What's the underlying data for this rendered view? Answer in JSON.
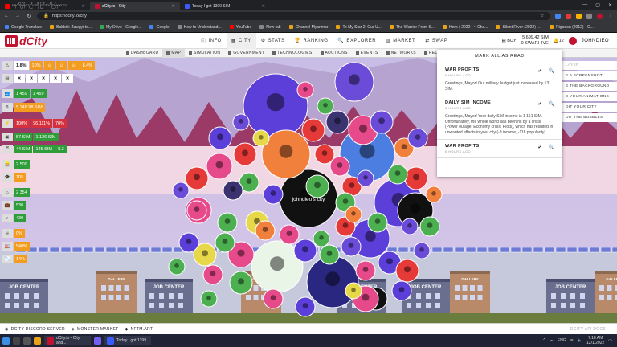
{
  "browser": {
    "tabs": [
      {
        "title": "မနက်ဖြန်လည်း တို့ပြင်ဆင်ကြမှာလား",
        "color": "#ff0000",
        "active": false
      },
      {
        "title": "dCity.io - City",
        "color": "#c3122f",
        "active": true
      },
      {
        "title": "Today I got 1399 SIM",
        "color": "#3a5cff",
        "active": false
      }
    ],
    "url": "https://dcity.io/city",
    "bookmarks": [
      "Google Translate",
      "Babbitt: Zawgyi to...",
      "My Drive - Google...",
      "Google",
      "How to Understand...",
      "YouTube",
      "New tab",
      "Channel Myanmar",
      "To My Star 2: Our U...",
      "The Warrior From S...",
      "Hero ( 2022 ) ~ Cha...",
      "Silent River (2022) -...",
      "Rigodon (2012) - C..."
    ]
  },
  "header": {
    "brand": "dCity",
    "nav": [
      {
        "label": "INFO",
        "icon": "info-icon",
        "active": false
      },
      {
        "label": "CITY",
        "icon": "city-icon",
        "active": true
      },
      {
        "label": "STATS",
        "icon": "stats-icon",
        "active": false
      },
      {
        "label": "RANKING",
        "icon": "ranking-icon",
        "active": false
      },
      {
        "label": "EXPLORER",
        "icon": "explorer-icon",
        "active": false
      },
      {
        "label": "MARKET",
        "icon": "market-icon",
        "active": false
      },
      {
        "label": "SWAP",
        "icon": "swap-icon",
        "active": false
      }
    ],
    "buy_label": "BUY",
    "balance_sim": "5 699.42 SIM",
    "balance_swap": "0 SWAP.HIVE",
    "notifications_count": "12",
    "username": "JOHNDIEO"
  },
  "subnav": [
    "DASHBOARD",
    "MAP",
    "SIMULATION",
    "GOVERNMENT",
    "TECHNOLOGIES",
    "AUCTIONS",
    "EVENTS",
    "NETWORKS",
    "RELIG"
  ],
  "subnav_active": "MAP",
  "left_panel": {
    "rows": [
      [
        "1.8%",
        "10%",
        "☺",
        "☺",
        "☺",
        "8.4%"
      ],
      [
        "✕",
        "✕",
        "✕",
        "✕",
        "✕"
      ],
      [
        "1 459",
        "1 459"
      ],
      [
        "5 148.98 SIM"
      ],
      [
        "100%",
        "96.111%",
        "70%"
      ],
      [
        "57 SIM",
        "1 126 SIM"
      ],
      [
        "44 SIM",
        "145 SIM",
        "8.3"
      ],
      [
        "2 509"
      ],
      [
        "105"
      ],
      [
        "2 354"
      ],
      [
        "530"
      ],
      [
        "439"
      ],
      [
        "0%"
      ],
      [
        "540%"
      ],
      [
        "14%"
      ]
    ]
  },
  "notifications": {
    "mark_all": "MARK ALL AS READ",
    "items": [
      {
        "title": "WAR PROFITS",
        "age": "6 HOURS AGO",
        "body": "Greetings, Mayor! Our military budget just increased by 131 SIM."
      },
      {
        "title": "DAILY SIM INCOME",
        "age": "6 HOURS AGO",
        "body": "Greetings, Mayor! Your daily SIM income is 1 161 SIM. Unfortunately, the whole world has been hit by a crisis (Power outage, Economy crisis, Riots), which has resulted in unwanted effects in your city (-9 income, -118 popularity)."
      },
      {
        "title": "WAR PROFITS",
        "age": "6 HOURS AGO",
        "body": ""
      }
    ]
  },
  "side_buttons": [
    "LAYER",
    "E A SCREENSHOT",
    "E THE BACKGROUND",
    "E YOUR ANIMATIONS",
    "DIT YOUR CITY",
    "DIT THE BUBBLES"
  ],
  "map": {
    "city_label": "johndieo's city",
    "buildings": [
      "JOB CENTER",
      "JOB CENTER",
      "JOB CENTER",
      "JOB CENTER",
      "JOB CENTER",
      "GALLERY",
      "GALLERY",
      "GALLERY",
      "GALLERY"
    ]
  },
  "footer": {
    "links": [
      "DCITY DISCORD SERVER",
      "MONSTER MARKET",
      "NFTM.ART"
    ],
    "right": "DCITY API DOCS"
  },
  "taskbar": {
    "apps": [
      "dCity.io - City and...",
      "",
      "Today I got 1399..."
    ],
    "lang": "ENG",
    "time": "7:18 AM",
    "date": "12/1/2022"
  }
}
